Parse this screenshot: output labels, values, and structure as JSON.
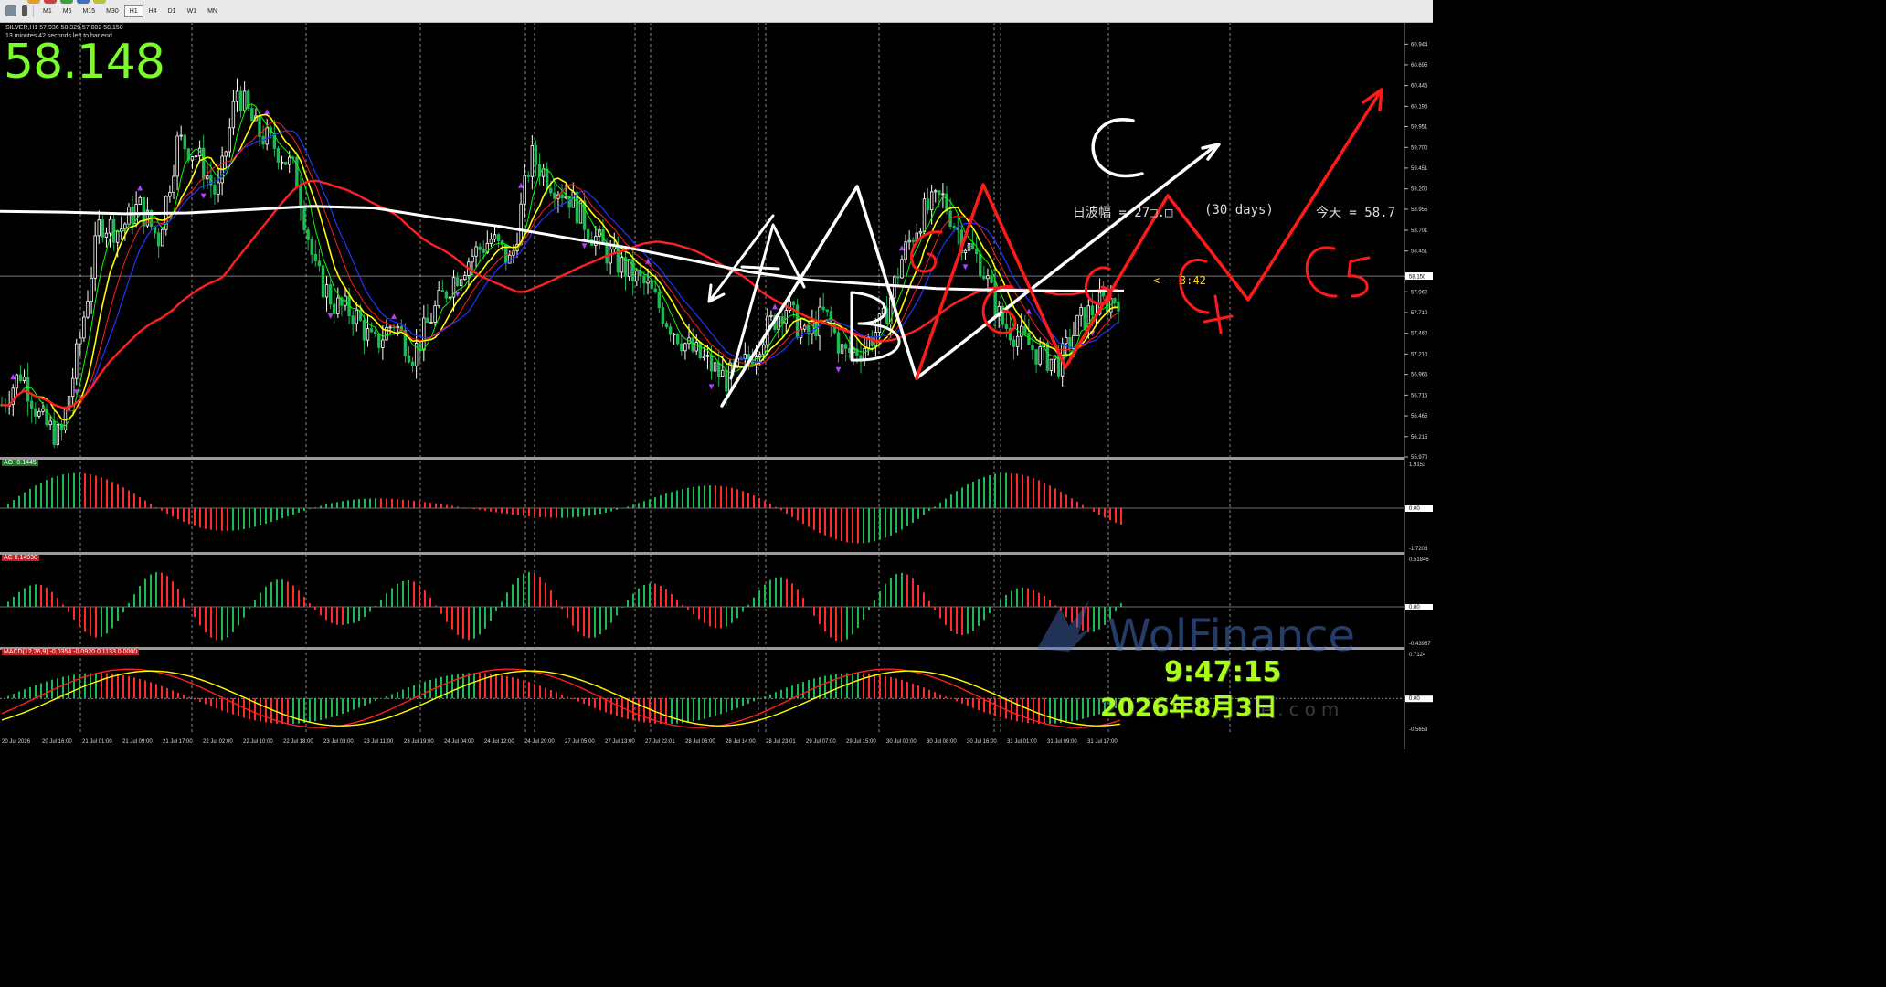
{
  "toolbar": {
    "timeframes": [
      "M1",
      "M5",
      "M15",
      "M30",
      "H1",
      "H4",
      "D1",
      "W1",
      "MN"
    ],
    "active": "H1"
  },
  "header": {
    "instrument_line": "SILVER,H1  57.936 58.329 57.802 58.150",
    "countdown": "13 minutes 42 seconds left to bar end",
    "big_price": "58.148"
  },
  "overlay": {
    "range_label": "日波幅 = 27□.□",
    "range_days": "(30 days)",
    "today_label": "今天 = 58.7",
    "timer_label": "<-- 3:42",
    "clock": "9:47:15",
    "date": "2026年8月3日",
    "watermark": "WolFinance",
    "watermark_sub": "e.com"
  },
  "colors": {
    "bg": "#000000",
    "bull": "#ffffff",
    "bear": "#1db954",
    "ma_fast": "#00ff00",
    "ma_yellow": "#ffff00",
    "ma_red": "#ff2020",
    "ma_blue": "#2233ff",
    "ma_white": "#ffffff",
    "osc_up": "#1db954",
    "osc_down": "#ff2a2a",
    "price_line": "#c0c0c0",
    "annotation_red": "#ff1a1a"
  },
  "chart_data": [
    {
      "type": "candlestick",
      "title": "SILVER,H1",
      "ylim": [
        55.97,
        61.19
      ],
      "yticks": [
        "60.944",
        "60.695",
        "60.445",
        "60.195",
        "59.951",
        "59.700",
        "59.451",
        "59.200",
        "58.955",
        "58.701",
        "58.451",
        "58.150",
        "57.960",
        "57.710",
        "57.460",
        "57.210",
        "56.965",
        "56.715",
        "56.465",
        "56.215",
        "55.970"
      ],
      "current_price": 58.15,
      "xticks": [
        "20 Jul 2026",
        "20 Jul 16:00",
        "21 Jul 01:00",
        "21 Jul 09:00",
        "21 Jul 17:00",
        "22 Jul 02:00",
        "22 Jul 10:00",
        "22 Jul 18:00",
        "23 Jul 03:00",
        "23 Jul 11:00",
        "23 Jul 19:00",
        "24 Jul 04:00",
        "24 Jul 12:00",
        "24 Jul 20:00",
        "27 Jul 05:00",
        "27 Jul 13:00",
        "27 Jul 22:01",
        "28 Jul 06:00",
        "28 Jul 14:00",
        "28 Jul 23:01",
        "29 Jul 07:00",
        "29 Jul 15:00",
        "30 Jul 00:00",
        "30 Jul 08:00",
        "30 Jul 16:00",
        "31 Jul 01:00",
        "31 Jul 09:00",
        "31 Jul 17:00"
      ],
      "close_path": [
        56.6,
        57.0,
        56.4,
        56.2,
        57.4,
        58.8,
        58.7,
        59.0,
        58.6,
        59.8,
        59.6,
        59.1,
        60.4,
        59.9,
        59.7,
        59.4,
        58.2,
        57.8,
        57.7,
        57.3,
        57.6,
        57.2,
        57.7,
        58.1,
        58.4,
        58.6,
        58.3,
        59.6,
        59.3,
        59.1,
        58.7,
        58.4,
        58.2,
        58.0,
        57.6,
        57.3,
        57.1,
        56.9,
        57.1,
        57.5,
        57.8,
        57.4,
        57.7,
        57.2,
        57.3,
        57.6,
        58.4,
        58.9,
        59.1,
        58.6,
        58.3,
        57.6,
        57.4,
        57.2,
        57.1,
        57.6,
        57.8,
        57.9
      ]
    },
    {
      "type": "bar",
      "title": "AO -0.1445",
      "ylim": [
        -1.7208,
        1.9153
      ],
      "yticks": [
        "1.9153",
        "0.00",
        "-1.7208"
      ]
    },
    {
      "type": "bar",
      "title": "AC 0.14930",
      "ylim": [
        -0.43967,
        0.51846
      ],
      "yticks": [
        "0.51846",
        "0.00",
        "-0.43967"
      ]
    },
    {
      "type": "line",
      "title": "MACD(12,26,9) -0.0354 -0.0920 0.1133 0.0000",
      "ylim": [
        -0.5653,
        0.7124
      ],
      "yticks": [
        "0.7124",
        "0.00",
        "-0.5653"
      ]
    }
  ],
  "annotations": {
    "labels_white": [
      "A",
      "B",
      "C"
    ],
    "labels_red": [
      "G",
      "G",
      "G",
      "C4",
      "C5"
    ]
  }
}
